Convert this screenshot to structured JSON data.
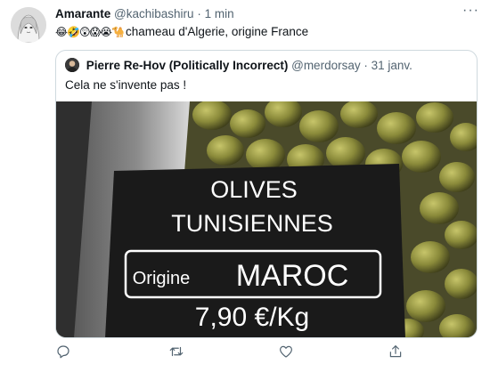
{
  "tweet": {
    "display_name": "Amarante",
    "handle": "@kachibashiru",
    "separator": "·",
    "time": "1 min",
    "more_label": "···",
    "emojis": "😂🤣😲😱😭🐪",
    "text": "chameau d'Algerie, origine France"
  },
  "quoted": {
    "display_name": "Pierre Re-Hov (Politically Incorrect)",
    "handle": "@merdorsay",
    "separator": "·",
    "date": "31 janv.",
    "text": "Cela ne s'invente pas !",
    "image": {
      "sign_line1": "OLIVES",
      "sign_line2": "TUNISIENNES",
      "origin_label": "Origine",
      "origin_country": "MAROC",
      "price": "7,90 €/Kg"
    }
  },
  "actions": {
    "icons": [
      "reply-icon",
      "retweet-icon",
      "like-icon",
      "share-icon"
    ]
  },
  "colors": {
    "text_primary": "#0f1419",
    "text_secondary": "#536471",
    "border": "#cfd9de",
    "accent": "#1d9bf0"
  }
}
